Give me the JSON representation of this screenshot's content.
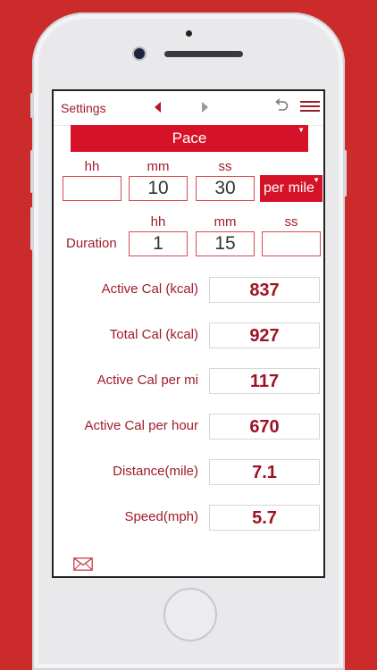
{
  "nav": {
    "settings_label": "Settings"
  },
  "mode": {
    "label": "Pace"
  },
  "pace": {
    "headers": [
      "hh",
      "mm",
      "ss"
    ],
    "hh": "",
    "mm": "10",
    "ss": "30",
    "unit": "per mile"
  },
  "duration": {
    "label": "Duration",
    "headers": [
      "hh",
      "mm",
      "ss"
    ],
    "hh": "1",
    "mm": "15",
    "ss": ""
  },
  "results": [
    {
      "label": "Active Cal (kcal)",
      "value": "837"
    },
    {
      "label": "Total Cal (kcal)",
      "value": "927"
    },
    {
      "label": "Active Cal per mi",
      "value": "117"
    },
    {
      "label": "Active Cal per hour",
      "value": "670"
    },
    {
      "label": "Distance(mile)",
      "value": "7.1"
    },
    {
      "label": "Speed(mph)",
      "value": "5.7"
    }
  ],
  "colors": {
    "accent": "#d51228",
    "text": "#a01c2a",
    "background": "#cc2b2b"
  },
  "icons": [
    "prev-arrow-icon",
    "next-arrow-icon",
    "undo-icon",
    "menu-icon",
    "mail-icon"
  ]
}
